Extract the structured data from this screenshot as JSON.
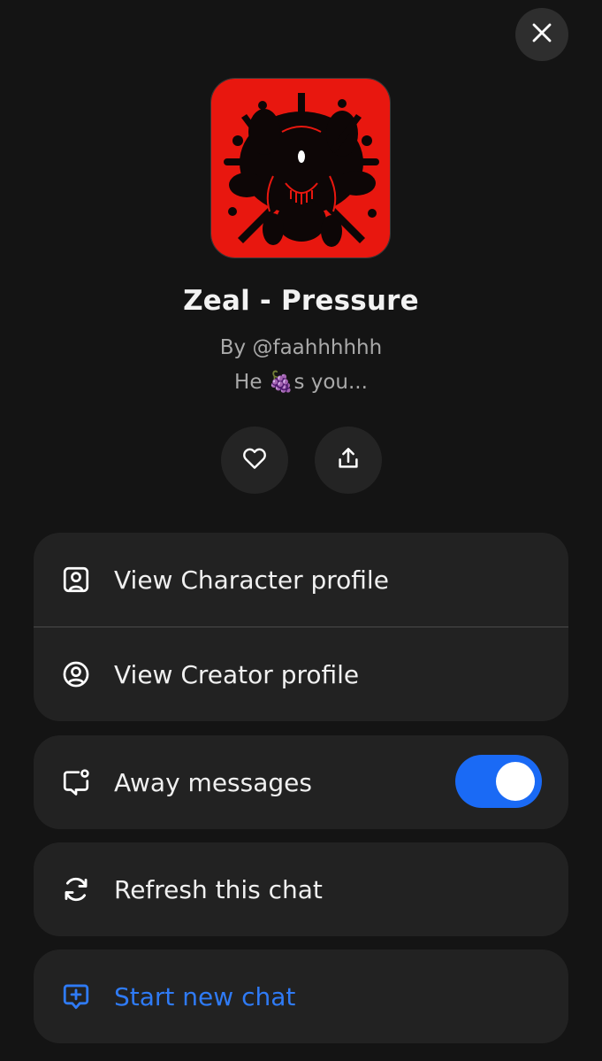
{
  "header": {
    "close_icon": "close-icon"
  },
  "character": {
    "name": "Zeal - Pressure",
    "byline": "By @faahhhhhh",
    "tagline": "He 🍇s you...",
    "avatar_colors": {
      "background": "#e8170f",
      "figure": "#0d0606"
    }
  },
  "actions": {
    "like_icon": "heart-icon",
    "share_icon": "share-icon"
  },
  "menu": {
    "profile_group": [
      {
        "label": "View Character profile",
        "icon": "character-profile-icon"
      },
      {
        "label": "View Creator profile",
        "icon": "creator-profile-icon"
      }
    ],
    "away": {
      "label": "Away messages",
      "icon": "away-message-icon",
      "enabled": true
    },
    "refresh": {
      "label": "Refresh this chat",
      "icon": "refresh-icon"
    },
    "new_chat": {
      "label": "Start new chat",
      "icon": "new-chat-icon"
    }
  },
  "colors": {
    "background": "#141414",
    "card": "#222222",
    "accent": "#2f7bf6",
    "toggle_on": "#1a6af5",
    "muted_text": "#a9a9a9"
  }
}
